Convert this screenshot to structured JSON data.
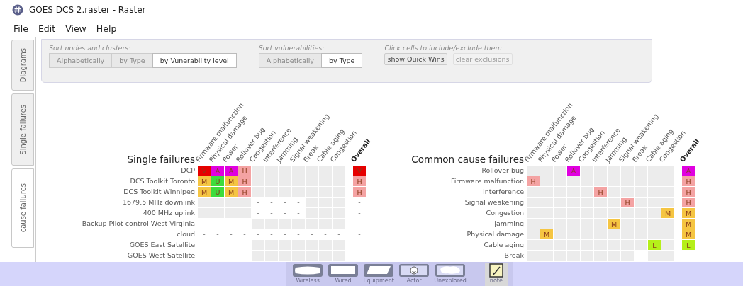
{
  "window": {
    "title": "GOES DCS 2.raster - Raster"
  },
  "menu": [
    "File",
    "Edit",
    "View",
    "Help"
  ],
  "side_tabs": [
    {
      "label": "Diagrams",
      "selected": false
    },
    {
      "label": "Single failures",
      "selected": false
    },
    {
      "label": "cause failures",
      "selected": true
    }
  ],
  "controls": {
    "sort_nodes": {
      "label": "Sort nodes and clusters:",
      "options": [
        {
          "label": "Alphabetically",
          "selected": false
        },
        {
          "label": "by Type",
          "selected": false
        },
        {
          "label": "by Vunerability level",
          "selected": true
        }
      ]
    },
    "sort_vulnerabilities": {
      "label": "Sort vulnerabilities:",
      "options": [
        {
          "label": "Alphabetically",
          "selected": false
        },
        {
          "label": "by Type",
          "selected": true
        }
      ]
    },
    "cells": {
      "label": "Click cells to include/exclude them",
      "buttons": [
        {
          "label": "show Quick Wins",
          "disabled": false
        },
        {
          "label": "clear exclusions",
          "disabled": true
        }
      ]
    }
  },
  "tables": [
    {
      "title": "Single failures",
      "columns": [
        "Firmware malfunction",
        "Physical damage",
        "Power",
        "Rollover bug",
        "Congestion",
        "Interference",
        "Jamming",
        "Signal weakening",
        "Break",
        "Cable aging",
        "Congestion"
      ],
      "overall": "Overall",
      "rows": [
        {
          "label": "DCP",
          "cells": [
            {
              "text": "V",
              "color": "#e60000"
            },
            {
              "text": "A",
              "color": "#e000e0"
            },
            {
              "text": "A",
              "color": "#e000e0"
            },
            {
              "text": "H",
              "color": "#f4a3a3"
            },
            null,
            null,
            null,
            null,
            null,
            null,
            null
          ],
          "overall": {
            "text": "V",
            "color": "#e60000"
          }
        },
        {
          "label": "DCS Toolkit Toronto",
          "cells": [
            {
              "text": "M",
              "color": "#f5c542"
            },
            {
              "text": "U",
              "color": "#3ddc3d"
            },
            {
              "text": "M",
              "color": "#f5c542"
            },
            {
              "text": "H",
              "color": "#f4a3a3"
            },
            null,
            null,
            null,
            null,
            null,
            null,
            null
          ],
          "overall": {
            "text": "H",
            "color": "#f4a3a3"
          }
        },
        {
          "label": "DCS Toolkit Winnipeg",
          "cells": [
            {
              "text": "M",
              "color": "#f5c542"
            },
            {
              "text": "U",
              "color": "#3ddc3d"
            },
            {
              "text": "M",
              "color": "#f5c542"
            },
            {
              "text": "H",
              "color": "#f4a3a3"
            },
            null,
            null,
            null,
            null,
            null,
            null,
            null
          ],
          "overall": {
            "text": "H",
            "color": "#f4a3a3"
          }
        },
        {
          "label": "1679.5 MHz downlink",
          "cells": [
            null,
            null,
            null,
            null,
            "-",
            "-",
            "-",
            "-",
            null,
            null,
            null
          ],
          "overall": "-"
        },
        {
          "label": "400 MHz uplink",
          "cells": [
            null,
            null,
            null,
            null,
            "-",
            "-",
            "-",
            "-",
            null,
            null,
            null
          ],
          "overall": "-"
        },
        {
          "label": "Backup Pilot control West Virginia",
          "cells": [
            "-",
            "-",
            "-",
            "-",
            null,
            null,
            null,
            null,
            null,
            null,
            null
          ],
          "overall": "-"
        },
        {
          "label": "cloud",
          "cells": [
            "-",
            "-",
            "-",
            "-",
            "-",
            "-",
            "-",
            "-",
            "-",
            "-",
            "-"
          ],
          "overall": "-"
        },
        {
          "label": "GOES East Satellite",
          "cells": [
            false,
            false,
            false,
            false,
            null,
            null,
            null,
            null,
            null,
            null,
            null
          ],
          "overall": false
        },
        {
          "label": "GOES West Satellite",
          "cells": [
            "-",
            "-",
            "-",
            "-",
            null,
            null,
            null,
            null,
            null,
            null,
            null
          ],
          "overall": "-"
        }
      ]
    },
    {
      "title": "Common cause failures",
      "columns": [
        "Firmware malfunction",
        "Physical damage",
        "Power",
        "Rollover bug",
        "Congestion",
        "Interference",
        "Jamming",
        "Signal weakening",
        "Break",
        "Cable aging",
        "Congestion"
      ],
      "overall": "Overall",
      "rows": [
        {
          "label": "Rollover bug",
          "cells": [
            null,
            null,
            null,
            {
              "text": "A",
              "color": "#e000e0"
            },
            null,
            null,
            null,
            null,
            null,
            null,
            null
          ],
          "overall": {
            "text": "A",
            "color": "#e000e0"
          }
        },
        {
          "label": "Firmware malfunction",
          "cells": [
            {
              "text": "H",
              "color": "#f4a3a3"
            },
            null,
            null,
            null,
            null,
            null,
            null,
            null,
            null,
            null,
            null
          ],
          "overall": {
            "text": "H",
            "color": "#f4a3a3"
          }
        },
        {
          "label": "Interference",
          "cells": [
            null,
            null,
            null,
            null,
            null,
            {
              "text": "H",
              "color": "#f4a3a3"
            },
            null,
            null,
            null,
            null,
            null
          ],
          "overall": {
            "text": "H",
            "color": "#f4a3a3"
          }
        },
        {
          "label": "Signal weakening",
          "cells": [
            null,
            null,
            null,
            null,
            null,
            null,
            null,
            {
              "text": "H",
              "color": "#f4a3a3"
            },
            null,
            null,
            null
          ],
          "overall": {
            "text": "H",
            "color": "#f4a3a3"
          }
        },
        {
          "label": "Congestion",
          "cells": [
            null,
            null,
            null,
            null,
            null,
            null,
            null,
            null,
            null,
            null,
            {
              "text": "M",
              "color": "#f5c542"
            }
          ],
          "overall": {
            "text": "M",
            "color": "#f5c542"
          }
        },
        {
          "label": "Jamming",
          "cells": [
            null,
            null,
            null,
            null,
            null,
            null,
            {
              "text": "M",
              "color": "#f5c542"
            },
            null,
            null,
            null,
            null
          ],
          "overall": {
            "text": "M",
            "color": "#f5c542"
          }
        },
        {
          "label": "Physical damage",
          "cells": [
            null,
            {
              "text": "M",
              "color": "#f5c542"
            },
            null,
            null,
            null,
            null,
            null,
            null,
            null,
            null,
            null
          ],
          "overall": {
            "text": "M",
            "color": "#f5c542"
          }
        },
        {
          "label": "Cable aging",
          "cells": [
            null,
            null,
            null,
            null,
            null,
            null,
            null,
            null,
            null,
            {
              "text": "L",
              "color": "#b5ef1a"
            },
            null
          ],
          "overall": {
            "text": "L",
            "color": "#b5ef1a"
          }
        },
        {
          "label": "Break",
          "cells": [
            null,
            null,
            null,
            null,
            null,
            null,
            null,
            null,
            "-",
            null,
            null
          ],
          "overall": "-"
        }
      ]
    }
  ],
  "palette": [
    {
      "label": "Wireless",
      "kind": "wireless"
    },
    {
      "label": "Wired",
      "kind": "wired"
    },
    {
      "label": "Equipment",
      "kind": "equipment"
    },
    {
      "label": "Actor",
      "kind": "actor"
    },
    {
      "label": "Unexplored",
      "kind": "unexplored"
    },
    {
      "label": "note",
      "kind": "note"
    }
  ]
}
